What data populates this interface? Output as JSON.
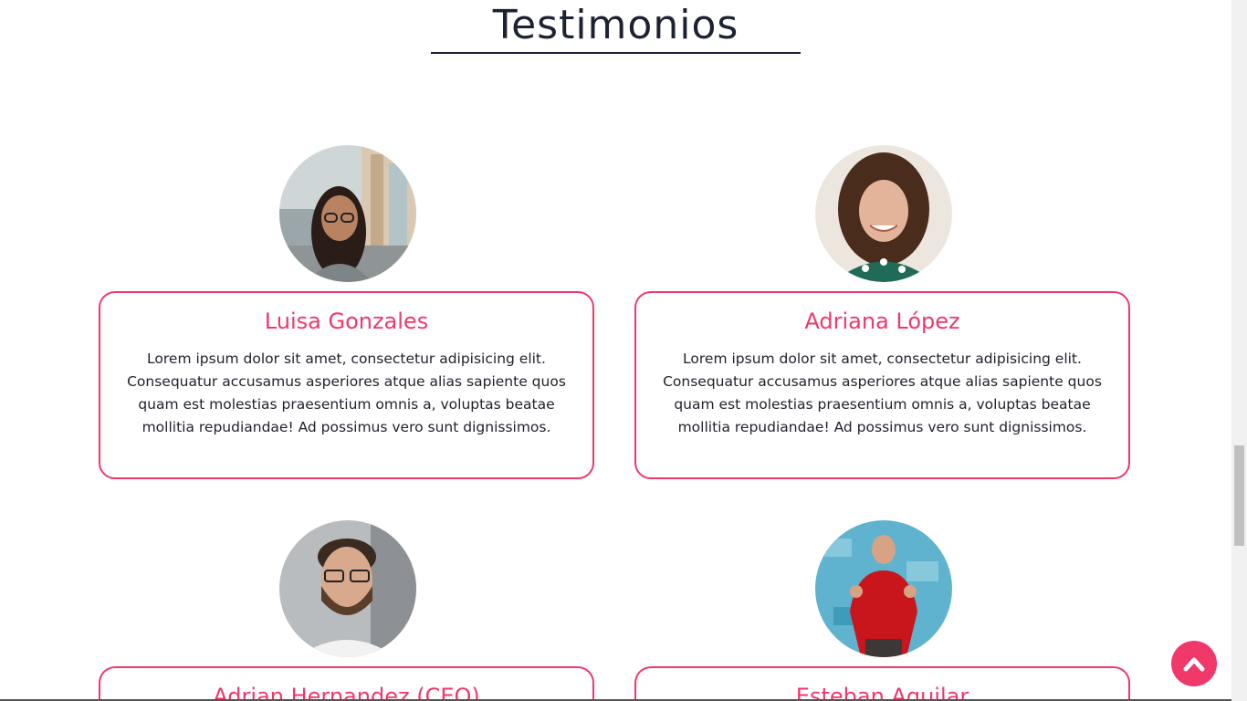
{
  "section": {
    "title": "Testimonios"
  },
  "testimonials": [
    {
      "name": "Luisa Gonzales",
      "text": "Lorem ipsum dolor sit amet, consectetur adipisicing elit. Consequatur accusamus asperiores atque alias sapiente quos quam est molestias praesentium omnis a, voluptas beatae mollitia repudiandae! Ad possimus vero sunt dignissimos.",
      "avatar": "woman-glasses-street-photo"
    },
    {
      "name": "Adriana López",
      "text": "Lorem ipsum dolor sit amet, consectetur adipisicing elit. Consequatur accusamus asperiores atque alias sapiente quos quam est molestias praesentium omnis a, voluptas beatae mollitia repudiandae! Ad possimus vero sunt dignissimos.",
      "avatar": "woman-curly-hair-photo"
    },
    {
      "name": "Adrian Hernandez (CEO)",
      "avatar": "man-glasses-beard-photo"
    },
    {
      "name": "Esteban Aguilar",
      "avatar": "man-red-sweater-photo"
    }
  ],
  "colors": {
    "accent": "#f0386b",
    "text": "#22222e",
    "title": "#1d2233"
  },
  "scroll_top": {
    "icon": "chevron-up-icon"
  }
}
